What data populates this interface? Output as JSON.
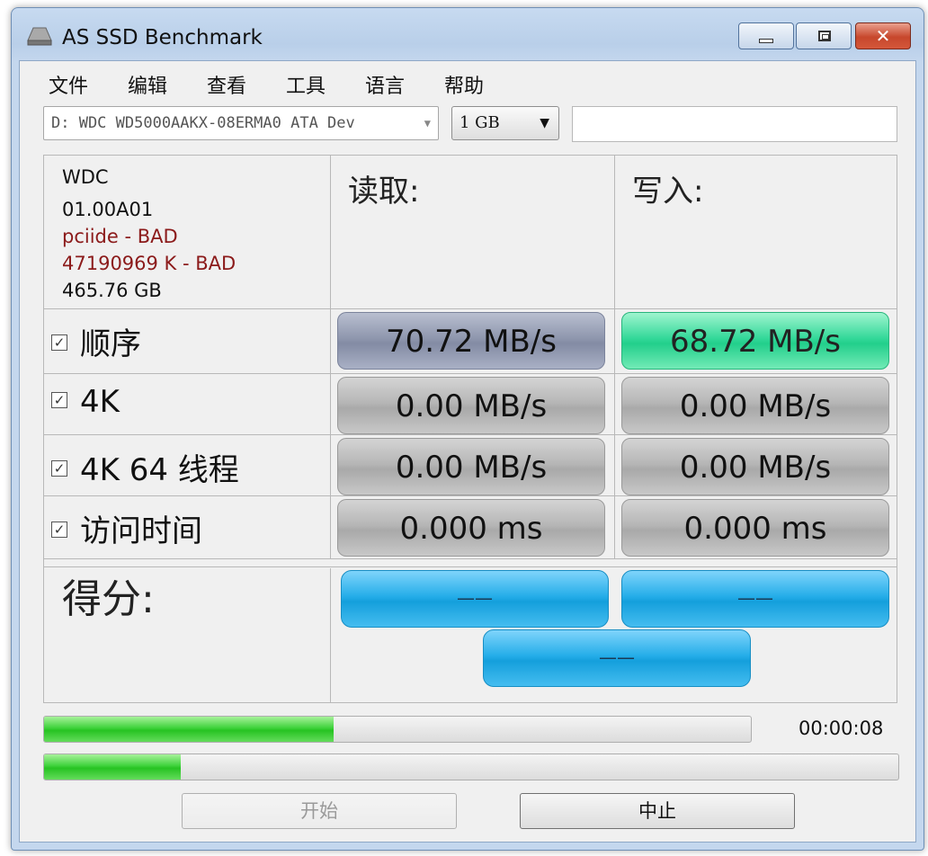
{
  "window": {
    "title": "AS SSD Benchmark"
  },
  "menu": [
    "文件",
    "编辑",
    "查看",
    "工具",
    "语言",
    "帮助"
  ],
  "drive_select": {
    "value": "D: WDC WD5000AAKX-08ERMA0 ATA Dev"
  },
  "size_select": {
    "value": "1 GB"
  },
  "drive_info": {
    "model": "WDC",
    "firmware": "01.00A01",
    "driver": "pciide - BAD",
    "alignment": "47190969 K - BAD",
    "capacity": "465.76 GB",
    "bad_color": "#8b1a1a"
  },
  "columns": {
    "read": "读取:",
    "write": "写入:"
  },
  "tests": [
    {
      "label": "顺序",
      "checked": true,
      "read": "70.72 MB/s",
      "write": "68.72 MB/s"
    },
    {
      "label": "4K",
      "checked": true,
      "read": "0.00 MB/s",
      "write": "0.00 MB/s"
    },
    {
      "label": "4K 64 线程",
      "checked": true,
      "read": "0.00 MB/s",
      "write": "0.00 MB/s"
    },
    {
      "label": "访问时间",
      "checked": true,
      "read": "0.000 ms",
      "write": "0.000 ms"
    }
  ],
  "score": {
    "label": "得分:",
    "read": "——",
    "write": "——",
    "total": "——"
  },
  "progress": {
    "overall": 0.41,
    "current": 0.16,
    "elapsed": "00:00:08"
  },
  "buttons": {
    "start": "开始",
    "abort": "中止"
  },
  "colors": {
    "seq_read": "#8f97ae",
    "seq_write": "#2fd596",
    "score": "#1fa9e4",
    "progress": "#33cb2f"
  }
}
